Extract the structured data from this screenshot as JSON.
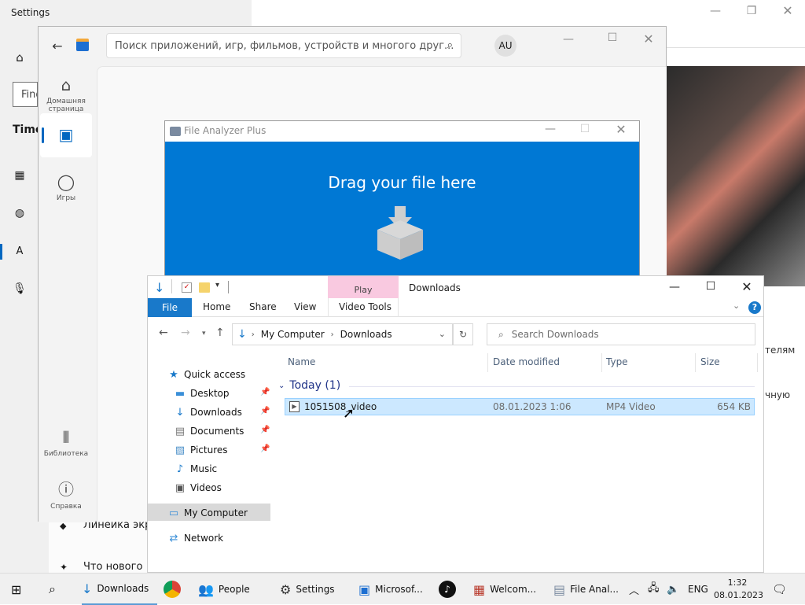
{
  "settings": {
    "title": "Settings",
    "find_placeholder": "Find",
    "time_heading": "Time",
    "items": [
      "Линейка экр",
      "Что нового"
    ],
    "right_snippets": [
      "телям",
      "чную"
    ],
    "icons": [
      "home-icon",
      "calendar-clock-icon",
      "globe-icon",
      "language-icon",
      "microphone-icon"
    ]
  },
  "store": {
    "search_placeholder": "Поиск приложений, игр, фильмов, устройств и многого друг...",
    "avatar": "AU",
    "rail": [
      {
        "label": "Домашняя страница",
        "icon": "home-icon"
      },
      {
        "label": "",
        "icon": "apps-icon"
      },
      {
        "label": "Игры",
        "icon": "gamepad-icon"
      },
      {
        "label": "Библиотека",
        "icon": "library-icon"
      },
      {
        "label": "Справка",
        "icon": "help-icon"
      }
    ]
  },
  "file_analyzer": {
    "title": "File Analyzer Plus",
    "drag_text": "Drag your file here"
  },
  "explorer": {
    "title": "Downloads",
    "contextual_tab": "Play",
    "tabs": [
      "File",
      "Home",
      "Share",
      "View",
      "Video Tools"
    ],
    "breadcrumb": [
      "My Computer",
      "Downloads"
    ],
    "search_placeholder": "Search Downloads",
    "nav": {
      "quick_access": "Quick access",
      "items": [
        "Desktop",
        "Downloads",
        "Documents",
        "Pictures",
        "Music",
        "Videos"
      ],
      "my_computer": "My Computer",
      "network": "Network"
    },
    "columns": [
      "Name",
      "Date modified",
      "Type",
      "Size"
    ],
    "group": "Today (1)",
    "files": [
      {
        "name": "1051508_video",
        "date": "08.01.2023 1:06",
        "type": "MP4 Video",
        "size": "654 KB"
      }
    ]
  },
  "taskbar": {
    "items": [
      "Downloads",
      "People",
      "Settings",
      "Microsof...",
      "Welcom...",
      "File Anal..."
    ],
    "lang": "ENG",
    "time": "1:32",
    "date": "08.01.2023"
  }
}
